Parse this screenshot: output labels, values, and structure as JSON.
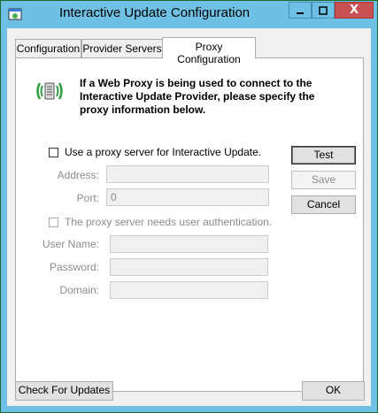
{
  "window": {
    "title": "Interactive Update Configuration",
    "close_glyph": "X",
    "accent_color": "#6ec1e4",
    "close_color": "#c75050"
  },
  "tabs": [
    {
      "label": "Configuration",
      "active": false
    },
    {
      "label": "Provider Servers",
      "active": false
    },
    {
      "label": "Proxy Configuration",
      "active": true
    }
  ],
  "proxy": {
    "icon": "proxy-icon",
    "info_text": "If a Web Proxy is being used to connect to the Interactive Update Provider, please specify the proxy information below.",
    "use_proxy_label": "Use a proxy server for Interactive Update.",
    "use_proxy_checked": false,
    "address_label": "Address:",
    "address_value": "",
    "port_label": "Port:",
    "port_value": "0",
    "auth_label": "The proxy server needs user authentication.",
    "auth_checked": false,
    "username_label": "User Name:",
    "username_value": "",
    "password_label": "Password:",
    "password_value": "",
    "domain_label": "Domain:",
    "domain_value": ""
  },
  "side_buttons": {
    "test": "Test",
    "save": "Save",
    "cancel": "Cancel"
  },
  "footer": {
    "check_updates": "Check For Updates",
    "ok": "OK"
  }
}
